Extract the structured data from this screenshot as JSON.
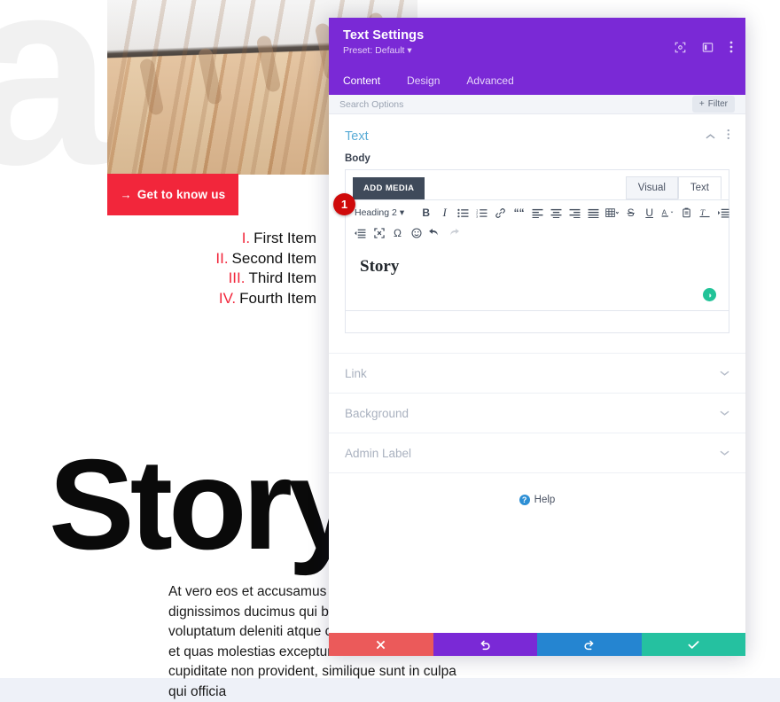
{
  "background_page": {
    "ghost_letters": "ab",
    "cta": {
      "arrow": "→",
      "label": "Get to know us"
    },
    "list": [
      {
        "num": "I.",
        "label": "First Item"
      },
      {
        "num": "II.",
        "label": "Second Item"
      },
      {
        "num": "III.",
        "label": "Third Item"
      },
      {
        "num": "IV.",
        "label": "Fourth Item"
      }
    ],
    "big_heading": "Story",
    "paragraph": "At vero eos et accusamus et iusto odio dignissimos ducimus qui blanditiis praesentium voluptatum deleniti atque corrupti quos dolores et quas molestias excepturi sint occaecati cupiditate non provident, similique sunt in culpa qui officia"
  },
  "modal": {
    "title": "Text Settings",
    "preset": "Preset: Default",
    "header_icons": [
      "focus-target-icon",
      "split-view-icon",
      "kebab-menu-icon"
    ],
    "tabs": [
      {
        "label": "Content",
        "active": true
      },
      {
        "label": "Design",
        "active": false
      },
      {
        "label": "Advanced",
        "active": false
      }
    ],
    "search": {
      "placeholder": "Search Options",
      "filter_label": "Filter",
      "filter_plus": "+"
    },
    "section": {
      "title": "Text",
      "collapse_icon": "chevron-up-icon",
      "menu_icon": "kebab-menu-icon",
      "field_label": "Body"
    },
    "editor": {
      "add_media": "ADD MEDIA",
      "view_tabs": [
        {
          "label": "Visual",
          "active": true
        },
        {
          "label": "Text",
          "active": false
        }
      ],
      "format_select": "Heading 2",
      "toolbar_row1": [
        "bold-icon",
        "italic-icon",
        "bulleted-list-icon",
        "numbered-list-icon",
        "link-icon",
        "blockquote-icon",
        "align-left-icon",
        "align-center-icon",
        "align-right-icon",
        "align-justify-icon",
        "table-icon",
        "strikethrough-icon",
        "underline-icon",
        "text-color-icon",
        "paste-as-text-icon",
        "clear-formatting-icon",
        "indent-icon"
      ],
      "toolbar_row2": [
        "outdent-icon",
        "fullscreen-icon",
        "special-character-icon",
        "emoji-icon",
        "undo-icon",
        "redo-icon"
      ],
      "content_html": "Story",
      "status_badge": "resize-handle-icon"
    },
    "accordion": [
      {
        "label": "Link",
        "icon": "chevron-down-icon"
      },
      {
        "label": "Background",
        "icon": "chevron-down-icon"
      },
      {
        "label": "Admin Label",
        "icon": "chevron-down-icon"
      }
    ],
    "help": {
      "label": "Help",
      "icon": "question-mark-icon"
    },
    "footer_buttons": [
      {
        "name": "cancel",
        "icon": "close-x-icon",
        "color": "#eb5a5a"
      },
      {
        "name": "undo",
        "icon": "undo-arrow-icon",
        "color": "#7a29d6"
      },
      {
        "name": "redo",
        "icon": "redo-arrow-icon",
        "color": "#2585d1"
      },
      {
        "name": "save",
        "icon": "checkmark-icon",
        "color": "#25c1a0"
      }
    ]
  },
  "annotation_marker": {
    "number": "1",
    "color": "#cf0a0a"
  }
}
